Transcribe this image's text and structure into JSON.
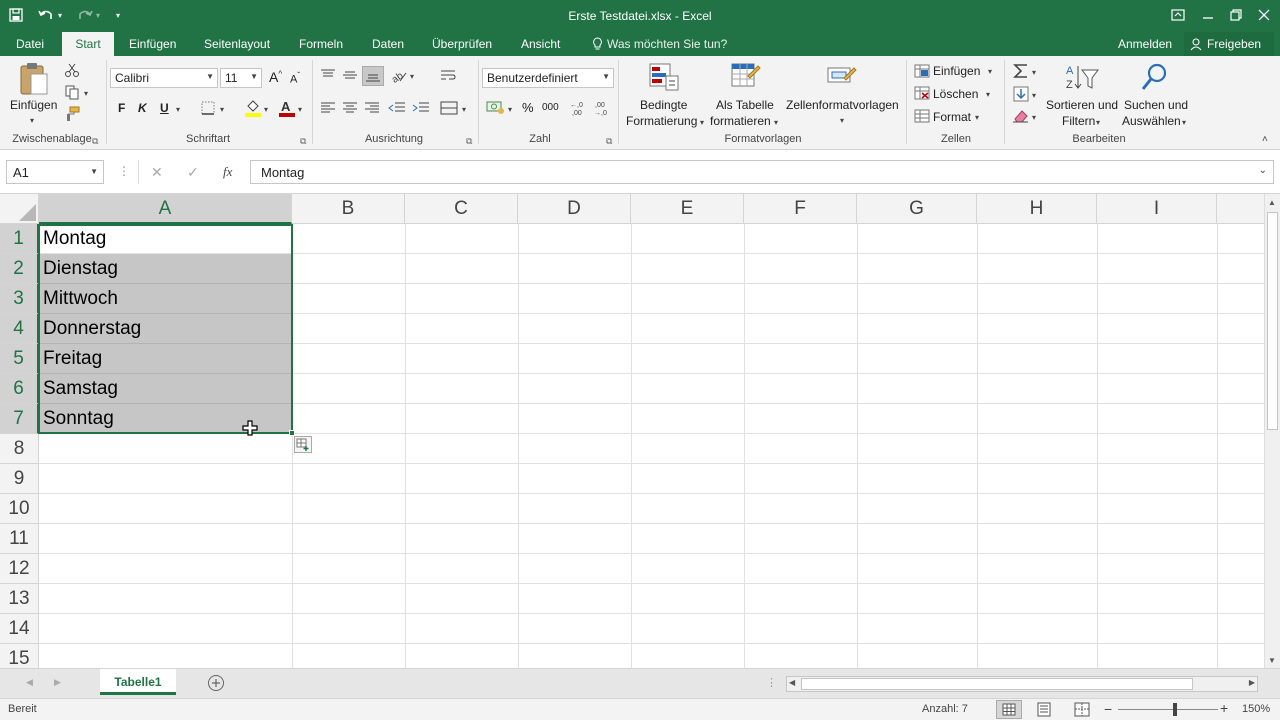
{
  "window": {
    "title": "Erste Testdatei.xlsx - Excel",
    "qat": {
      "undo_arrow": "▾",
      "redo_arrow": "▾",
      "more": "▾"
    }
  },
  "tabs": [
    {
      "label": "Datei"
    },
    {
      "label": "Start"
    },
    {
      "label": "Einfügen"
    },
    {
      "label": "Seitenlayout"
    },
    {
      "label": "Formeln"
    },
    {
      "label": "Daten"
    },
    {
      "label": "Überprüfen"
    },
    {
      "label": "Ansicht"
    }
  ],
  "tellme": "Was möchten Sie tun?",
  "account": {
    "signin": "Anmelden",
    "share": "Freigeben"
  },
  "ribbon": {
    "clipboard": {
      "label": "Zwischenablage",
      "paste": "Einfügen"
    },
    "font": {
      "label": "Schriftart",
      "name": "Calibri",
      "size": "11",
      "bold": "F",
      "italic": "K",
      "underline": "U"
    },
    "alignment": {
      "label": "Ausrichtung"
    },
    "number": {
      "label": "Zahl",
      "format": "Benutzerdefiniert",
      "percent": "%",
      "thousands": "000"
    },
    "styles": {
      "label": "Formatvorlagen",
      "conditional_1": "Bedingte",
      "conditional_2": "Formatierung",
      "table_1": "Als Tabelle",
      "table_2": "formatieren",
      "cellstyles": "Zellenformatvorlagen"
    },
    "cells": {
      "label": "Zellen",
      "insert": "Einfügen",
      "delete": "Löschen",
      "format": "Format"
    },
    "editing": {
      "label": "Bearbeiten",
      "sort_1": "Sortieren und",
      "sort_2": "Filtern",
      "find_1": "Suchen und",
      "find_2": "Auswählen"
    }
  },
  "formula_bar": {
    "name_box": "A1",
    "fx": "fx",
    "content": "Montag"
  },
  "columns": [
    "A",
    "B",
    "C",
    "D",
    "E",
    "F",
    "G",
    "H",
    "I"
  ],
  "rows": [
    "1",
    "2",
    "3",
    "4",
    "5",
    "6",
    "7",
    "8",
    "9",
    "10",
    "11",
    "12",
    "13",
    "14",
    "15"
  ],
  "cells_a": [
    "Montag",
    "Dienstag",
    "Mittwoch",
    "Donnerstag",
    "Freitag",
    "Samstag",
    "Sonntag"
  ],
  "sheet": {
    "tab": "Tabelle1"
  },
  "status": {
    "ready": "Bereit",
    "count": "Anzahl: 7",
    "zoom": "150%"
  },
  "colors": {
    "accent": "#217346",
    "selection": "#c6c6c6"
  }
}
